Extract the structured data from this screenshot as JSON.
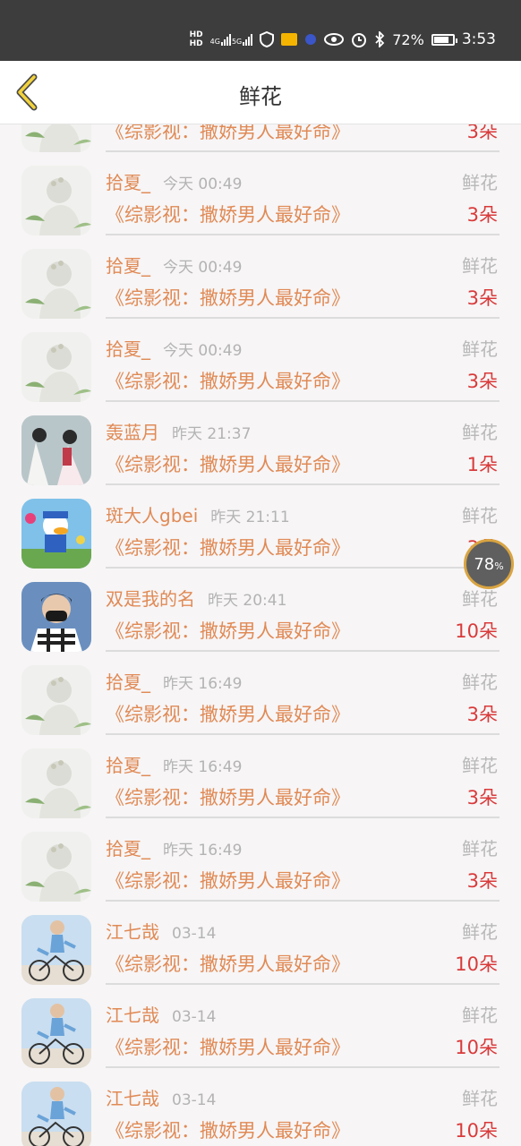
{
  "status_bar": {
    "hd1": "HD",
    "hd2": "HD",
    "net1": "4G",
    "net2": "5G",
    "battery_percent": "72%",
    "time": "3:53",
    "icons": [
      "signal-icon",
      "vpn-icon",
      "mail-icon",
      "app-icon",
      "eye-icon",
      "alarm-icon",
      "bluetooth-icon",
      "battery-icon"
    ]
  },
  "header": {
    "title": "鲜花",
    "back_icon": "chevron-left-icon"
  },
  "rows": [
    {
      "user": "拾夏_",
      "time": "今天 00:49",
      "category": "鲜花",
      "book": "《综影视：撒娇男人最好命》",
      "count": "3朵",
      "avatar": "avatar-girl"
    },
    {
      "user": "拾夏_",
      "time": "今天 00:49",
      "category": "鲜花",
      "book": "《综影视：撒娇男人最好命》",
      "count": "3朵",
      "avatar": "avatar-girl"
    },
    {
      "user": "拾夏_",
      "time": "今天 00:49",
      "category": "鲜花",
      "book": "《综影视：撒娇男人最好命》",
      "count": "3朵",
      "avatar": "avatar-girl"
    },
    {
      "user": "拾夏_",
      "time": "今天 00:49",
      "category": "鲜花",
      "book": "《综影视：撒娇男人最好命》",
      "count": "3朵",
      "avatar": "avatar-girl"
    },
    {
      "user": "轰蓝月",
      "time": "昨天 21:37",
      "category": "鲜花",
      "book": "《综影视：撒娇男人最好命》",
      "count": "1朵",
      "avatar": "avatar-costume"
    },
    {
      "user": "斑大人gbei",
      "time": "昨天 21:11",
      "category": "鲜花",
      "book": "《综影视：撒娇男人最好命》",
      "count": "3朵",
      "avatar": "avatar-donald"
    },
    {
      "user": "双是我的名",
      "time": "昨天 20:41",
      "category": "鲜花",
      "book": "《综影视：撒娇男人最好命》",
      "count": "10朵",
      "avatar": "avatar-mask"
    },
    {
      "user": "拾夏_",
      "time": "昨天 16:49",
      "category": "鲜花",
      "book": "《综影视：撒娇男人最好命》",
      "count": "3朵",
      "avatar": "avatar-girl"
    },
    {
      "user": "拾夏_",
      "time": "昨天 16:49",
      "category": "鲜花",
      "book": "《综影视：撒娇男人最好命》",
      "count": "3朵",
      "avatar": "avatar-girl"
    },
    {
      "user": "拾夏_",
      "time": "昨天 16:49",
      "category": "鲜花",
      "book": "《综影视：撒娇男人最好命》",
      "count": "3朵",
      "avatar": "avatar-girl"
    },
    {
      "user": "江七哉",
      "time": "03-14",
      "category": "鲜花",
      "book": "《综影视：撒娇男人最好命》",
      "count": "10朵",
      "avatar": "avatar-bike"
    },
    {
      "user": "江七哉",
      "time": "03-14",
      "category": "鲜花",
      "book": "《综影视：撒娇男人最好命》",
      "count": "10朵",
      "avatar": "avatar-bike"
    },
    {
      "user": "江七哉",
      "time": "03-14",
      "category": "鲜花",
      "book": "《综影视：撒娇男人最好命》",
      "count": "10朵",
      "avatar": "avatar-bike"
    }
  ],
  "floating_badge": {
    "value": "78",
    "unit": "%"
  },
  "colors": {
    "accent": "#e08a55",
    "count": "#d93a3a",
    "muted": "#b8b8b8",
    "status_bar": "#3d3d3d"
  }
}
